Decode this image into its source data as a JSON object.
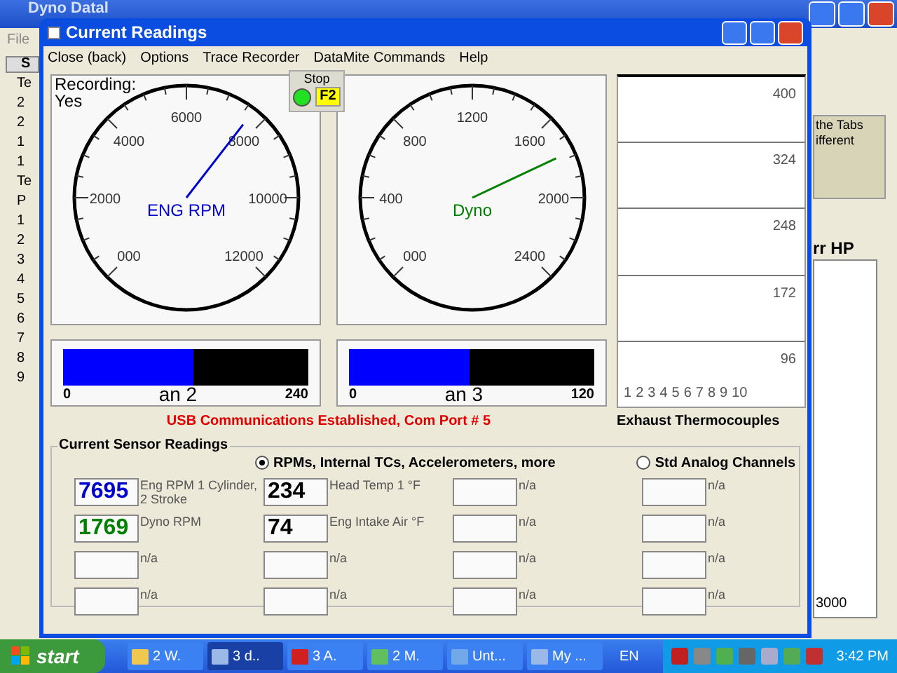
{
  "background_window": {
    "title": "Dyno Datal",
    "menu": [
      "File"
    ],
    "left_fragments": [
      "S",
      "Te",
      "2",
      "2",
      "1",
      "1",
      "Te",
      "P",
      "1",
      "2",
      "3",
      "4",
      "5",
      "6",
      "7",
      "8",
      "9"
    ],
    "note_lines": [
      "the Tabs",
      "ifferent"
    ],
    "chart_title": "rr HP",
    "chart_tick": "3000"
  },
  "window": {
    "title": "Current Readings"
  },
  "menu": [
    "Close (back)",
    "Options",
    "Trace Recorder",
    "DataMite Commands",
    "Help"
  ],
  "stop": {
    "label": "Stop",
    "key": "F2",
    "on": true
  },
  "recording": {
    "label": "Recording:",
    "value": "Yes"
  },
  "gauges": [
    {
      "name": "ENG RPM",
      "color": "#0000cc",
      "level": 0.64,
      "scale": [
        "000",
        "2000",
        "4000",
        "6000",
        "8000",
        "10000",
        "12000"
      ]
    },
    {
      "name": "Dyno",
      "color": "#008000",
      "level": 0.74,
      "scale": [
        "000",
        "400",
        "800",
        "1200",
        "1600",
        "2000",
        "2400"
      ]
    }
  ],
  "bars": [
    {
      "name": "an 2",
      "min": "0",
      "max": "240",
      "level": 0.53
    },
    {
      "name": "an 3",
      "min": "0",
      "max": "120",
      "level": 0.49
    }
  ],
  "thermocouples": {
    "title": "Exhaust Thermocouples",
    "y_labels": [
      "400",
      "324",
      "248",
      "172",
      "96"
    ],
    "x_labels": [
      "1",
      "2",
      "3",
      "4",
      "5",
      "6",
      "7",
      "8",
      "9",
      "10"
    ]
  },
  "status": "USB Communications Established, Com Port # 5",
  "sensors": {
    "title": "Current Sensor Readings",
    "modes": [
      {
        "label": "RPMs, Internal TCs, Accelerometers, more",
        "selected": true
      },
      {
        "label": "Std Analog Channels",
        "selected": false
      }
    ],
    "columns": [
      [
        {
          "value": "7695",
          "color": "#0000cc",
          "label": "Eng RPM   1 Cylinder,  2 Stroke"
        },
        {
          "value": "1769",
          "color": "#008000",
          "label": "Dyno RPM"
        },
        {
          "label": "n/a"
        },
        {
          "label": "n/a"
        }
      ],
      [
        {
          "value": "234",
          "color": "#000000",
          "label": "Head Temp 1 °F"
        },
        {
          "value": "74",
          "color": "#000000",
          "label": "Eng Intake Air °F"
        },
        {
          "label": "n/a"
        },
        {
          "label": "n/a"
        }
      ],
      [
        {
          "label": "n/a"
        },
        {
          "label": "n/a"
        },
        {
          "label": "n/a"
        },
        {
          "label": "n/a"
        }
      ],
      [
        {
          "label": "n/a"
        },
        {
          "label": "n/a"
        },
        {
          "label": "n/a"
        },
        {
          "label": "n/a"
        }
      ]
    ]
  },
  "taskbar": {
    "start": "start",
    "items": [
      {
        "label": "2 W.",
        "kind": "folder",
        "selected": false
      },
      {
        "label": "3 d..",
        "kind": "app",
        "selected": true
      },
      {
        "label": "3 A.",
        "kind": "pdf",
        "selected": false
      },
      {
        "label": "2 M.",
        "kind": "people",
        "selected": false
      },
      {
        "label": "Unt...",
        "kind": "doc",
        "selected": false
      },
      {
        "label": "My ...",
        "kind": "app",
        "selected": false
      }
    ],
    "language": "EN",
    "clock": "3:42 PM"
  }
}
